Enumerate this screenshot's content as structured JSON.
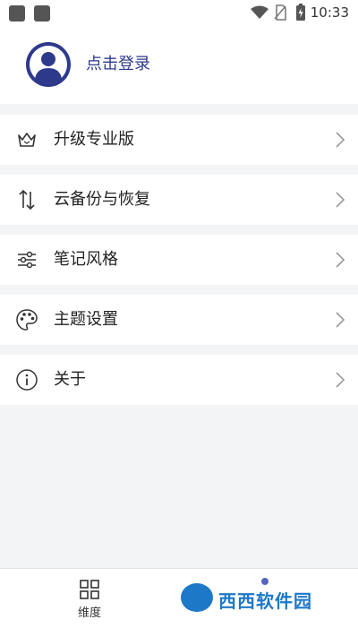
{
  "status_bar": {
    "time": "10:33"
  },
  "profile": {
    "login_label": "点击登录"
  },
  "menu": [
    {
      "label": "升级专业版",
      "icon": "crown-icon"
    },
    {
      "label": "云备份与恢复",
      "icon": "sync-arrows-icon"
    },
    {
      "label": "笔记风格",
      "icon": "sliders-icon"
    },
    {
      "label": "主题设置",
      "icon": "palette-icon"
    },
    {
      "label": "关于",
      "icon": "info-icon"
    }
  ],
  "bottom_nav": {
    "tabs": [
      {
        "label": "维度",
        "icon": "grid-icon"
      }
    ]
  },
  "watermark": {
    "text": "西西软件园"
  },
  "colors": {
    "accent": "#2d3a8c",
    "background": "#f3f4f6",
    "surface": "#ffffff"
  }
}
